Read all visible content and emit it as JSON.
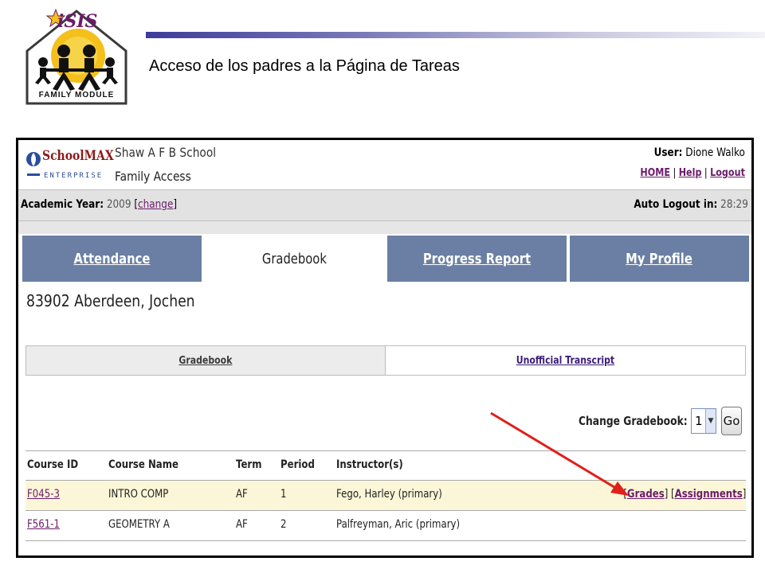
{
  "slide": {
    "title": "Acceso de los padres a la Página de Tareas",
    "logo_text": "iSIS",
    "logo_caption": "FAMILY MODULE"
  },
  "header": {
    "brand": "SchoolMAX",
    "brand_sub": "ENTERPRISE",
    "school": "Shaw A F B School",
    "app": "Family Access",
    "user_label": "User:",
    "user_name": "Dione Walko",
    "nav": {
      "home": "HOME",
      "help": "Help",
      "logout": "Logout"
    }
  },
  "yearbar": {
    "year_label": "Academic Year:",
    "year_value": "2009",
    "change_link": "change",
    "logout_label": "Auto Logout in:",
    "logout_time": "28:29"
  },
  "tabs": [
    {
      "label": "Attendance",
      "active": false
    },
    {
      "label": "Gradebook",
      "active": true
    },
    {
      "label": "Progress Report",
      "active": false
    },
    {
      "label": "My Profile",
      "active": false
    }
  ],
  "student": "83902 Aberdeen, Jochen",
  "subtabs": [
    {
      "label": "Gradebook"
    },
    {
      "label": "Unofficial Transcript"
    }
  ],
  "gradebook_select": {
    "label": "Change Gradebook:",
    "value": "1",
    "go": "Go"
  },
  "grid": {
    "headers": [
      "Course ID",
      "Course Name",
      "Term",
      "Period",
      "Instructor(s)"
    ],
    "rows": [
      {
        "course_id": "F045-3",
        "name": "INTRO COMP",
        "term": "AF",
        "period": "1",
        "instructor": "Fego, Harley (primary)",
        "grades": "Grades",
        "assignments": "Assignments"
      },
      {
        "course_id": "F561-1",
        "name": "GEOMETRY A",
        "term": "AF",
        "period": "2",
        "instructor": "Palfreyman, Aric (primary)"
      }
    ]
  },
  "colors": {
    "tab_blue": "#6a7fa3",
    "link_purple": "#6b1b6b",
    "highlight_row": "#fbf6d7",
    "arrow_red": "#e0201a"
  }
}
